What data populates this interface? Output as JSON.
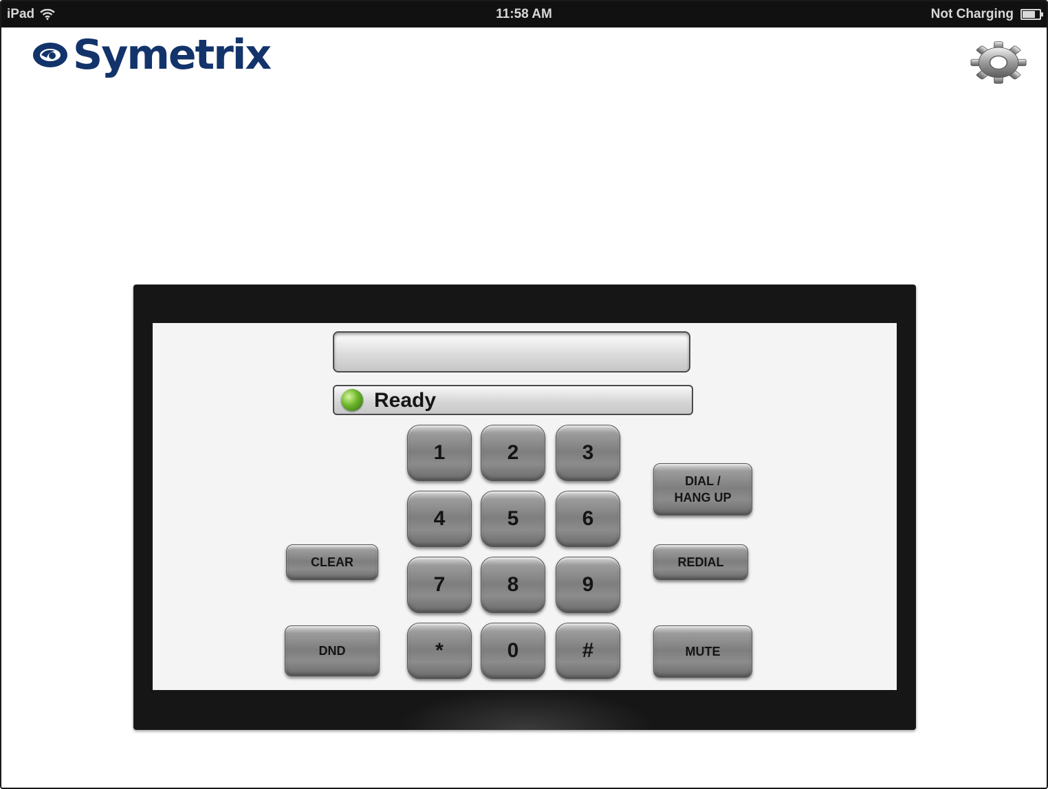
{
  "statusbar": {
    "device": "iPad",
    "time": "11:58 AM",
    "charging": "Not Charging",
    "battery_level": 0.75
  },
  "header": {
    "logo_text": "Symetrix",
    "brand_color": "#13336b"
  },
  "dialer": {
    "number_value": "",
    "status_text": "Ready",
    "status_color": "#6bb52a",
    "keys": [
      "1",
      "2",
      "3",
      "4",
      "5",
      "6",
      "7",
      "8",
      "9",
      "*",
      "0",
      "#"
    ],
    "clear_label": "CLEAR",
    "dnd_label": "DND",
    "dial_label": "DIAL /\nHANG UP",
    "redial_label": "REDIAL",
    "mute_label": "MUTE"
  }
}
